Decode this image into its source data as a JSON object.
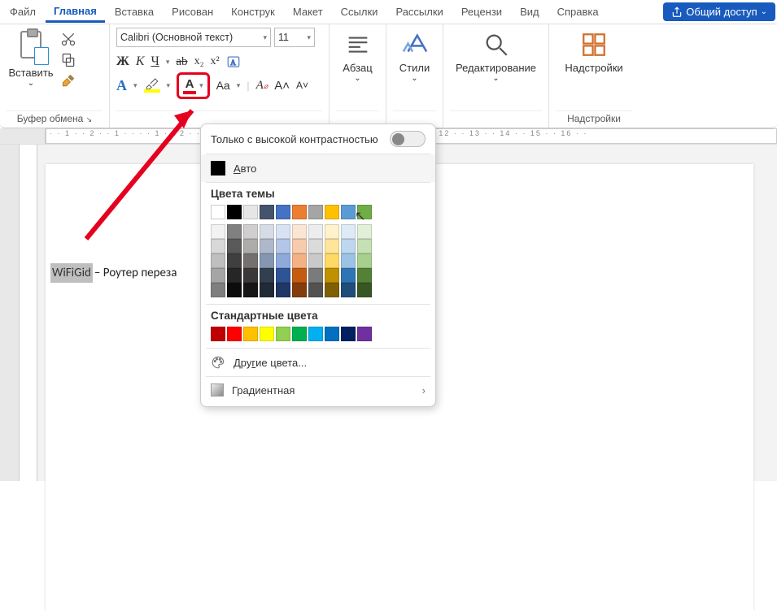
{
  "tabs": {
    "file": "Файл",
    "home": "Главная",
    "insert": "Вставка",
    "draw": "Рисован",
    "design": "Конструк",
    "layout": "Макет",
    "refs": "Ссылки",
    "mail": "Рассылки",
    "review": "Рецензи",
    "view": "Вид",
    "help": "Справка"
  },
  "share": "Общий доступ",
  "ribbon": {
    "clipboard": {
      "paste": "Вставить",
      "group": "Буфер обмена"
    },
    "font": {
      "name": "Calibri (Основной текст)",
      "size": "11",
      "bold": "Ж",
      "italic": "К",
      "underline": "Ч",
      "strike": "ab",
      "sub": "x₂",
      "sup": "x²",
      "texteffects": "A",
      "case": "Aa",
      "clear": "A",
      "grow": "A˄",
      "shrink": "A˅"
    },
    "paragraph": "Абзац",
    "styles": "Стили",
    "editing": "Редактирование",
    "addins": "Надстройки",
    "addins_group": "Надстройки"
  },
  "popup": {
    "high_contrast": "Только с высокой контрастностью",
    "auto": "Авто",
    "theme_title": "Цвета темы",
    "standard_title": "Стандартные цвета",
    "more_colors": "Другие цвета...",
    "gradient": "Градиентная",
    "theme_base": [
      "#FFFFFF",
      "#000000",
      "#E7E6E6",
      "#44546A",
      "#4472C4",
      "#ED7D31",
      "#A5A5A5",
      "#FFC000",
      "#5B9BD5",
      "#70AD47"
    ],
    "theme_shades": [
      [
        "#F2F2F2",
        "#808080",
        "#D0CECE",
        "#D6DCE4",
        "#D9E2F3",
        "#FBE5D5",
        "#EDEDED",
        "#FFF2CC",
        "#DEEBF6",
        "#E2EFD9"
      ],
      [
        "#D8D8D8",
        "#595959",
        "#AEABAB",
        "#ADB9CA",
        "#B4C6E7",
        "#F7CBAC",
        "#DBDBDB",
        "#FEE599",
        "#BDD7EE",
        "#C5E0B3"
      ],
      [
        "#BFBFBF",
        "#3F3F3F",
        "#757070",
        "#8496B0",
        "#8EAADB",
        "#F4B183",
        "#C9C9C9",
        "#FFD965",
        "#9CC3E5",
        "#A8D08D"
      ],
      [
        "#A5A5A5",
        "#262626",
        "#3A3838",
        "#323F4F",
        "#2F5496",
        "#C55A11",
        "#7B7B7B",
        "#BF9000",
        "#2E75B5",
        "#538135"
      ],
      [
        "#7F7F7F",
        "#0C0C0C",
        "#171616",
        "#222A35",
        "#1F3864",
        "#833C0B",
        "#525252",
        "#7F6000",
        "#1E4E79",
        "#375623"
      ]
    ],
    "standard": [
      "#C00000",
      "#FF0000",
      "#FFC000",
      "#FFFF00",
      "#92D050",
      "#00B050",
      "#00B0F0",
      "#0070C0",
      "#002060",
      "#7030A0"
    ]
  },
  "document": {
    "selected": "WiFiGid",
    "rest": " – Роутер переза"
  }
}
